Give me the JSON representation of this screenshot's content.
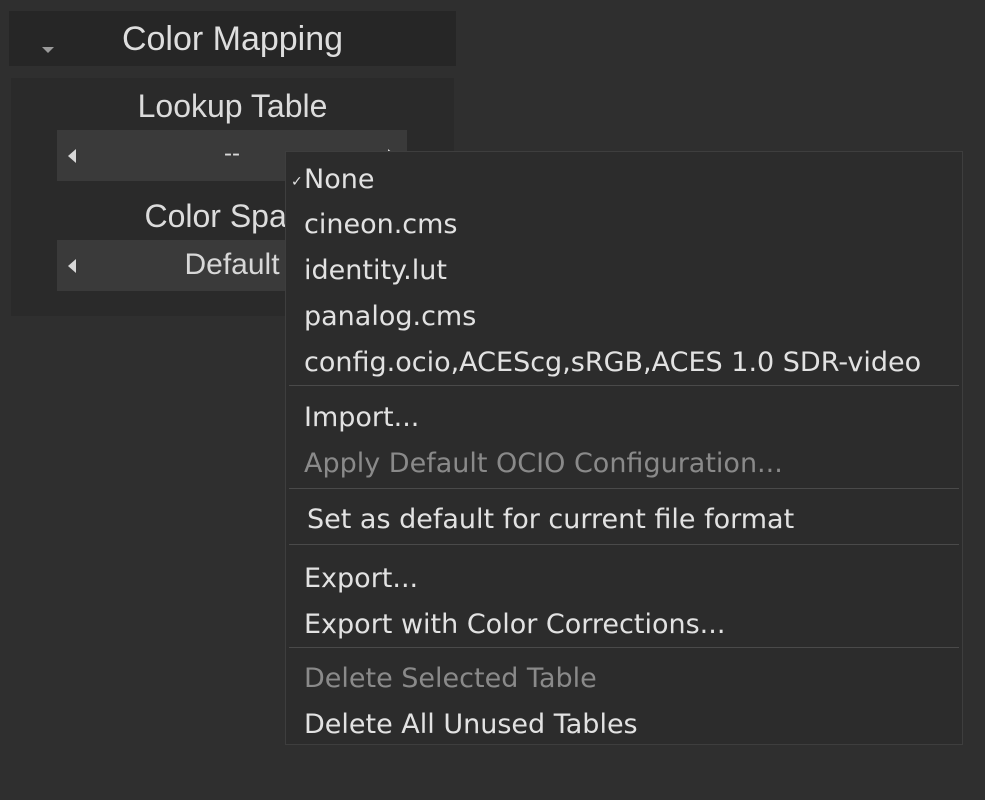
{
  "section": {
    "title": "Color Mapping"
  },
  "lookup_table": {
    "label": "Lookup Table",
    "value": "--"
  },
  "color_space": {
    "label": "Color Space",
    "value": "Default"
  },
  "menu": {
    "tables": [
      {
        "label": "None",
        "checked": true
      },
      {
        "label": "cineon.cms"
      },
      {
        "label": "identity.lut"
      },
      {
        "label": "panalog.cms"
      },
      {
        "label": "config.ocio,ACEScg,sRGB,ACES 1.0 SDR-video"
      }
    ],
    "import_label": "Import...",
    "apply_ocio_label": "Apply Default OCIO Configuration...",
    "set_default_label": "Set as default for current file format",
    "export_label": "Export...",
    "export_cc_label": "Export with Color Corrections...",
    "delete_selected_label": "Delete Selected Table",
    "delete_unused_label": "Delete All Unused Tables"
  }
}
